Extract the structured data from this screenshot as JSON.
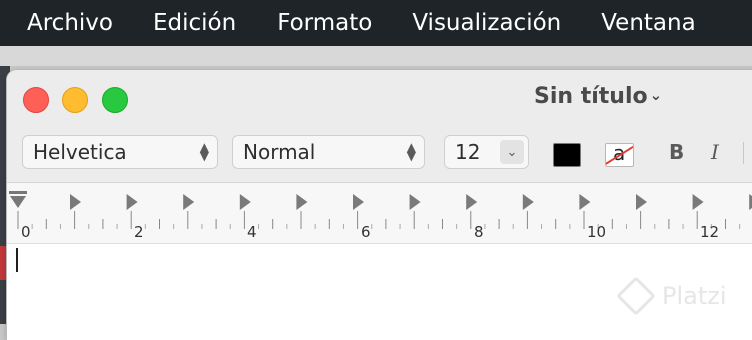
{
  "menubar": {
    "items": [
      "Archivo",
      "Edición",
      "Formato",
      "Visualización",
      "Ventana"
    ]
  },
  "window": {
    "title": "Sin título",
    "title_chevron_icon": "chevron-down-icon"
  },
  "format_bar": {
    "font_family": "Helvetica",
    "font_style": "Normal",
    "font_size": "12",
    "text_color": "#000000",
    "background_color_icon": "a",
    "bold_label": "B",
    "italic_label": "I"
  },
  "ruler": {
    "labels": [
      "0",
      "2",
      "4",
      "6",
      "8",
      "10",
      "12"
    ]
  },
  "watermark": {
    "text": "Platzi"
  }
}
